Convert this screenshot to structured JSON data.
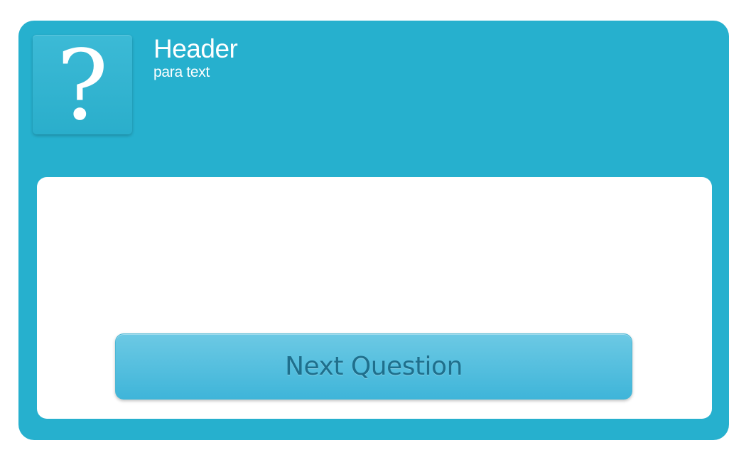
{
  "card": {
    "icon": {
      "name": "question-mark-icon",
      "glyph": "?"
    },
    "header": {
      "title": "Header",
      "para": "para text"
    },
    "button": {
      "label": "Next Question"
    }
  },
  "colors": {
    "card_background": "#26b0ce",
    "panel_background": "#ffffff",
    "button_gradient_top": "#6cc9e4",
    "button_gradient_bottom": "#3fb5d9",
    "button_text": "#1f6f8c",
    "header_text": "#ffffff"
  }
}
